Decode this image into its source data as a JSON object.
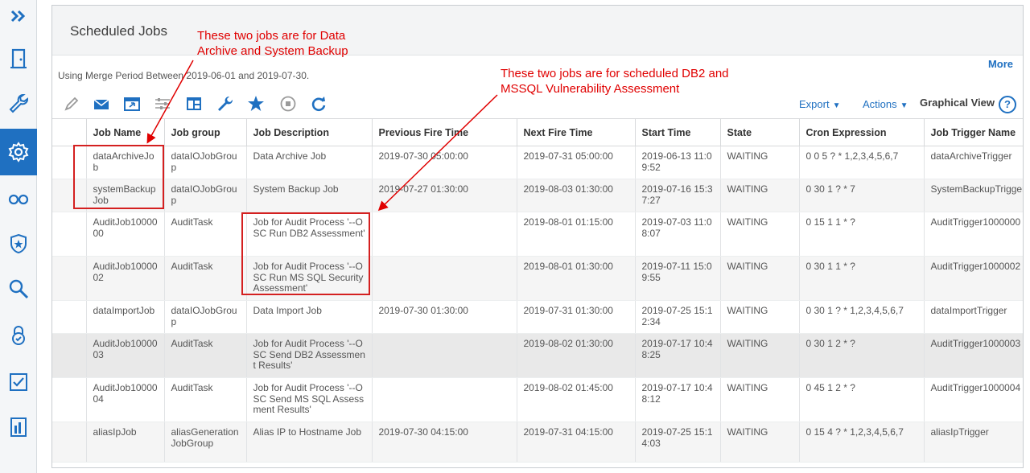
{
  "page": {
    "title": "Scheduled Jobs",
    "more_label": "More",
    "merge_period": "Using Merge Period Between 2019-06-01 and 2019-07-30."
  },
  "toolbar": {
    "export_label": "Export",
    "actions_label": "Actions",
    "graphical_view_label": "Graphical View",
    "help_label": "?"
  },
  "table": {
    "columns": [
      "Job Name",
      "Job group",
      "Job Description",
      "Previous Fire Time",
      "Next Fire Time",
      "Start Time",
      "State",
      "Cron Expression",
      "Job Trigger Name"
    ],
    "rows": [
      [
        "dataArchiveJob",
        "dataIOJobGroup",
        "Data Archive Job",
        "2019-07-30 05:00:00",
        "2019-07-31 05:00:00",
        "2019-06-13 11:09:52",
        "WAITING",
        "0 0 5 ? * 1,2,3,4,5,6,7",
        "dataArchiveTrigger"
      ],
      [
        "systemBackupJob",
        "dataIOJobGroup",
        "System Backup Job",
        "2019-07-27 01:30:00",
        "2019-08-03 01:30:00",
        "2019-07-16 15:37:27",
        "WAITING",
        "0 30 1 ? * 7",
        "SystemBackupTrigger"
      ],
      [
        "AuditJob1000000",
        "AuditTask",
        "Job for Audit Process '--OSC Run DB2 Assessment'",
        "",
        "2019-08-01 01:15:00",
        "2019-07-03 11:08:07",
        "WAITING",
        "0 15 1 1 * ?",
        "AuditTrigger1000000"
      ],
      [
        "AuditJob1000002",
        "AuditTask",
        "Job for Audit Process '--OSC Run MS SQL Security Assessment'",
        "",
        "2019-08-01 01:30:00",
        "2019-07-11 15:09:55",
        "WAITING",
        "0 30 1 1 * ?",
        "AuditTrigger1000002"
      ],
      [
        "dataImportJob",
        "dataIOJobGroup",
        "Data Import Job",
        "2019-07-30 01:30:00",
        "2019-07-31 01:30:00",
        "2019-07-25 15:12:34",
        "WAITING",
        "0 30 1 ? * 1,2,3,4,5,6,7",
        "dataImportTrigger"
      ],
      [
        "AuditJob1000003",
        "AuditTask",
        "Job for Audit Process '--OSC Send DB2 Assessment Results'",
        "",
        "2019-08-02 01:30:00",
        "2019-07-17 10:48:25",
        "WAITING",
        "0 30 1 2 * ?",
        "AuditTrigger1000003"
      ],
      [
        "AuditJob1000004",
        "AuditTask",
        "Job for Audit Process '--OSC Send MS SQL Assessment Results'",
        "",
        "2019-08-02 01:45:00",
        "2019-07-17 10:48:12",
        "WAITING",
        "0 45 1 2 * ?",
        "AuditTrigger1000004"
      ],
      [
        "aliasIpJob",
        "aliasGenerationJobGroup",
        "Alias IP to Hostname Job",
        "2019-07-30 04:15:00",
        "2019-07-31 04:15:00",
        "2019-07-25 15:14:03",
        "WAITING",
        "0 15 4 ? * 1,2,3,4,5,6,7",
        "aliasIpTrigger"
      ]
    ]
  },
  "annotations": {
    "note1": "These two jobs are for Data Archive and System Backup",
    "note2": "These two jobs are for scheduled DB2 and MSSQL  Vulnerability Assessment"
  },
  "colors": {
    "accent": "#1f70c1",
    "annotation": "#e00000"
  },
  "icons": {
    "sidebar": [
      "expand-icon",
      "door-icon",
      "wrench-icon",
      "gear-icon",
      "glasses-icon",
      "shield-star-icon",
      "search-icon",
      "lock-icon",
      "checklist-icon",
      "report-icon"
    ],
    "toolbar": [
      "pencil-icon",
      "mail-icon",
      "window-icon",
      "sliders-icon",
      "layout-icon",
      "wrench-icon",
      "star-icon",
      "stop-icon",
      "refresh-icon"
    ]
  }
}
